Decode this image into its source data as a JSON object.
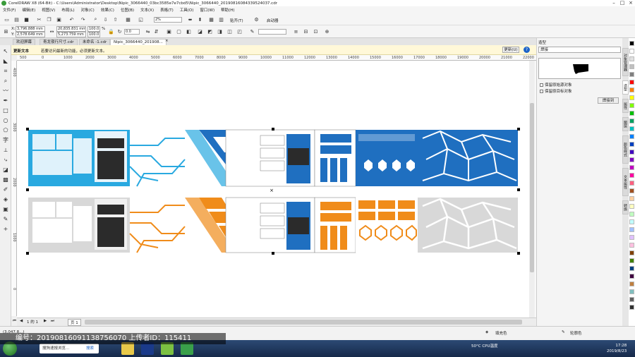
{
  "window": {
    "title": "CorelDRAW X8 (64-Bit) - C:\\Users\\Administrator\\Desktop\\Nipic_3066440_03bc3585e7e7cbd5\\Nipic_3066440_20190816084339524037.cdr"
  },
  "menu": [
    "文件(F)",
    "编辑(E)",
    "视图(V)",
    "布局(L)",
    "对象(C)",
    "效果(C)",
    "位图(B)",
    "文本(X)",
    "表格(T)",
    "工具(O)",
    "窗口(W)",
    "帮助(H)"
  ],
  "toolbar": {
    "zoom": "2%",
    "snap": "贴齐(T)",
    "launch": "启动器"
  },
  "props": {
    "x_label": "X:",
    "x_value": "3,796.888 mm",
    "y_label": "Y:",
    "y_value": "2,578.649 mm",
    "w_value": "20,835.831 mm",
    "h_value": "5,273.759 mm",
    "sx": "100.0",
    "sy": "100.0",
    "pct": "%",
    "angle": "0.0"
  },
  "tabs": [
    {
      "label": "欢迎屏幕",
      "active": false
    },
    {
      "label": "青龙夜行尺寸.cdr",
      "active": false
    },
    {
      "label": "未命名 -1.cdr",
      "active": false
    },
    {
      "label": "Nipic_3066440_201908...",
      "active": true
    }
  ],
  "notice": {
    "title": "更新文本",
    "message": "若要访问最新的功能，必须更新文本。",
    "button": "更新(U)",
    "help": "?"
  },
  "ruler_top": [
    "500",
    "0",
    "1000",
    "2000",
    "3000",
    "4000",
    "5000",
    "6000",
    "7000",
    "8000",
    "9000",
    "10000",
    "11000",
    "12000",
    "13000",
    "14000",
    "15000",
    "16000",
    "17000",
    "18000",
    "19000",
    "20000",
    "21000",
    "22000"
  ],
  "ruler_left": [
    "4000",
    "3000",
    "2000",
    "1000",
    "0"
  ],
  "docker": {
    "header": "造型",
    "mode": "焊接",
    "opt1": "保留原始源对象",
    "opt2": "保留原目标对象",
    "apply": "焊接到"
  },
  "docker_tabs": [
    "对象管理器",
    "造型",
    "属性",
    "图层",
    "颜色样式",
    "文本属性",
    "转换"
  ],
  "page_nav": {
    "current": "1 的 1",
    "page": "页 1"
  },
  "status": {
    "coords": "(3,047.8...)",
    "fill_label": "填充色",
    "stroke_label": "轮廓色"
  },
  "taskbar": {
    "search_label": "搜狗速报浏览...",
    "search_btn": "搜索",
    "temp": "50°C",
    "cpu": "CPU温度",
    "time": "17:28",
    "date": "2019/8/23"
  },
  "watermark": "编号：20190816091138756070 上传者ID：115411",
  "palette": [
    "#000000",
    "#ffffff",
    "#e0e0e0",
    "#c0c0c0",
    "#808080",
    "#ff0000",
    "#ff8000",
    "#ffff00",
    "#80ff00",
    "#00c000",
    "#00a060",
    "#00c0c0",
    "#0080ff",
    "#0040c0",
    "#4000c0",
    "#8000c0",
    "#c000c0",
    "#ff00a0",
    "#ff6080",
    "#a05020",
    "#ffd0a0",
    "#ffffc0",
    "#c0ffc0",
    "#c0ffff",
    "#a0c0ff",
    "#e0c0ff",
    "#ffc0e0",
    "#804000",
    "#408000",
    "#004080",
    "#400040",
    "#c08040",
    "#80c0c0",
    "#606060",
    "#303030"
  ],
  "colors": {
    "blue": "#1f6fc0",
    "cyan": "#29a9e0",
    "orange": "#f08c1a",
    "gray": "#d8d8d8",
    "dark": "#2b2b2b"
  }
}
